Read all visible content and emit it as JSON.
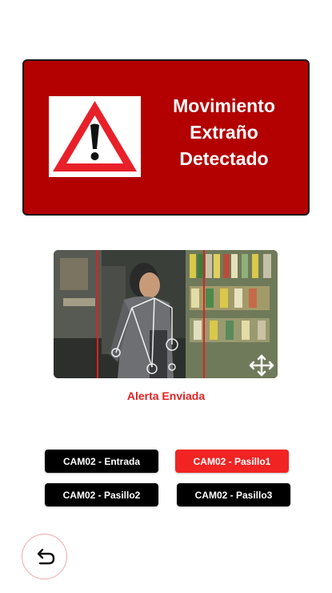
{
  "alert": {
    "title": "Movimiento\nExtraño\nDetectado",
    "banner_color": "#b30000",
    "icon": "warning-triangle-icon"
  },
  "camera": {
    "status_text": "Alerta Enviada",
    "status_color": "#e42222",
    "expand_icon": "expand-arrows-icon"
  },
  "cameras": [
    {
      "label": "CAM02 - Entrada",
      "active": false
    },
    {
      "label": "CAM02 - Pasillo1",
      "active": true
    },
    {
      "label": "CAM02 - Pasillo2",
      "active": false
    },
    {
      "label": "CAM02 - Pasillo3",
      "active": false
    }
  ],
  "colors": {
    "active_button": "#f12323",
    "inactive_button": "#000000"
  },
  "navigation": {
    "back_icon": "return-arrow-icon"
  }
}
